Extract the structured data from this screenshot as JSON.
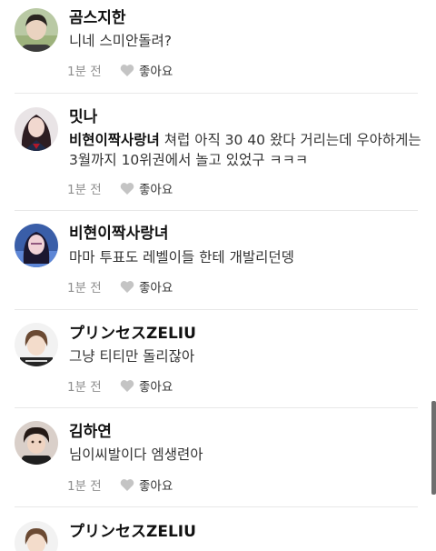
{
  "comments": [
    {
      "author": "곰스지한",
      "text": "니네 스미안돌려?",
      "time": "1분 전",
      "like_label": "좋아요"
    },
    {
      "author": "밋나",
      "mention": "비현이짝사랑녀",
      "text": "쳐럽 아직 30 40 왔다 거리는데 우아하게는 3월까지 10위권에서 놀고 있었구 ㅋㅋㅋ",
      "time": "1분 전",
      "like_label": "좋아요"
    },
    {
      "author": "비현이짝사랑녀",
      "text": "마마 투표도 레벨이들 한테 개발리던뎅",
      "time": "1분 전",
      "like_label": "좋아요"
    },
    {
      "author": "プリンセスZELIU",
      "text": "그냥 티티만 돌리잖아",
      "time": "1분 전",
      "like_label": "좋아요"
    },
    {
      "author": "김하연",
      "text": "님이씨발이다 엠생련아",
      "time": "1분 전",
      "like_label": "좋아요"
    },
    {
      "author": "プリンセスZELIU",
      "text": "",
      "time": "",
      "like_label": ""
    }
  ],
  "colors": {
    "author": "#111111",
    "body": "#333333",
    "meta": "#8e8e8e",
    "heart": "#c4c4c4",
    "divider": "#e8e8e8",
    "scrollbar": "#6e6e6e"
  }
}
